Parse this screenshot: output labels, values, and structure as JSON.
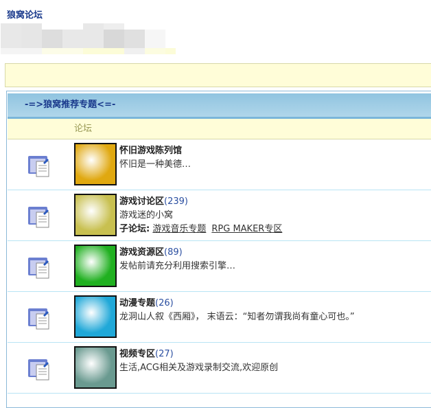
{
  "site_title": "狼窝论坛",
  "section_title": "-=>狼窝推荐专题<=-",
  "column_header": "论坛",
  "subforum_label": "子论坛:",
  "forums": [
    {
      "name": "怀旧游戏陈列馆",
      "count": "",
      "desc": "怀旧是一种美德…",
      "thumb_color": "#e0a810",
      "subforums": []
    },
    {
      "name": "游戏讨论区",
      "count": "(239)",
      "desc": "游戏迷的小窝",
      "thumb_color": "#c8c050",
      "subforums": [
        "游戏音乐专题",
        "RPG MAKER专区"
      ]
    },
    {
      "name": "游戏资源区",
      "count": "(89)",
      "desc": "发帖前请充分利用搜索引擎…",
      "thumb_color": "#20b020",
      "subforums": []
    },
    {
      "name": "动漫专题",
      "count": "(26)",
      "desc": "龙洞山人叙《西厢》， 末语云：“知者勿谓我尚有童心可也。”",
      "thumb_color": "#20a8d8",
      "subforums": []
    },
    {
      "name": "视频专区",
      "count": "(27)",
      "desc": "生活,ACG相关及游戏录制交流,欢迎原创",
      "thumb_color": "#6a9a90",
      "subforums": []
    }
  ]
}
